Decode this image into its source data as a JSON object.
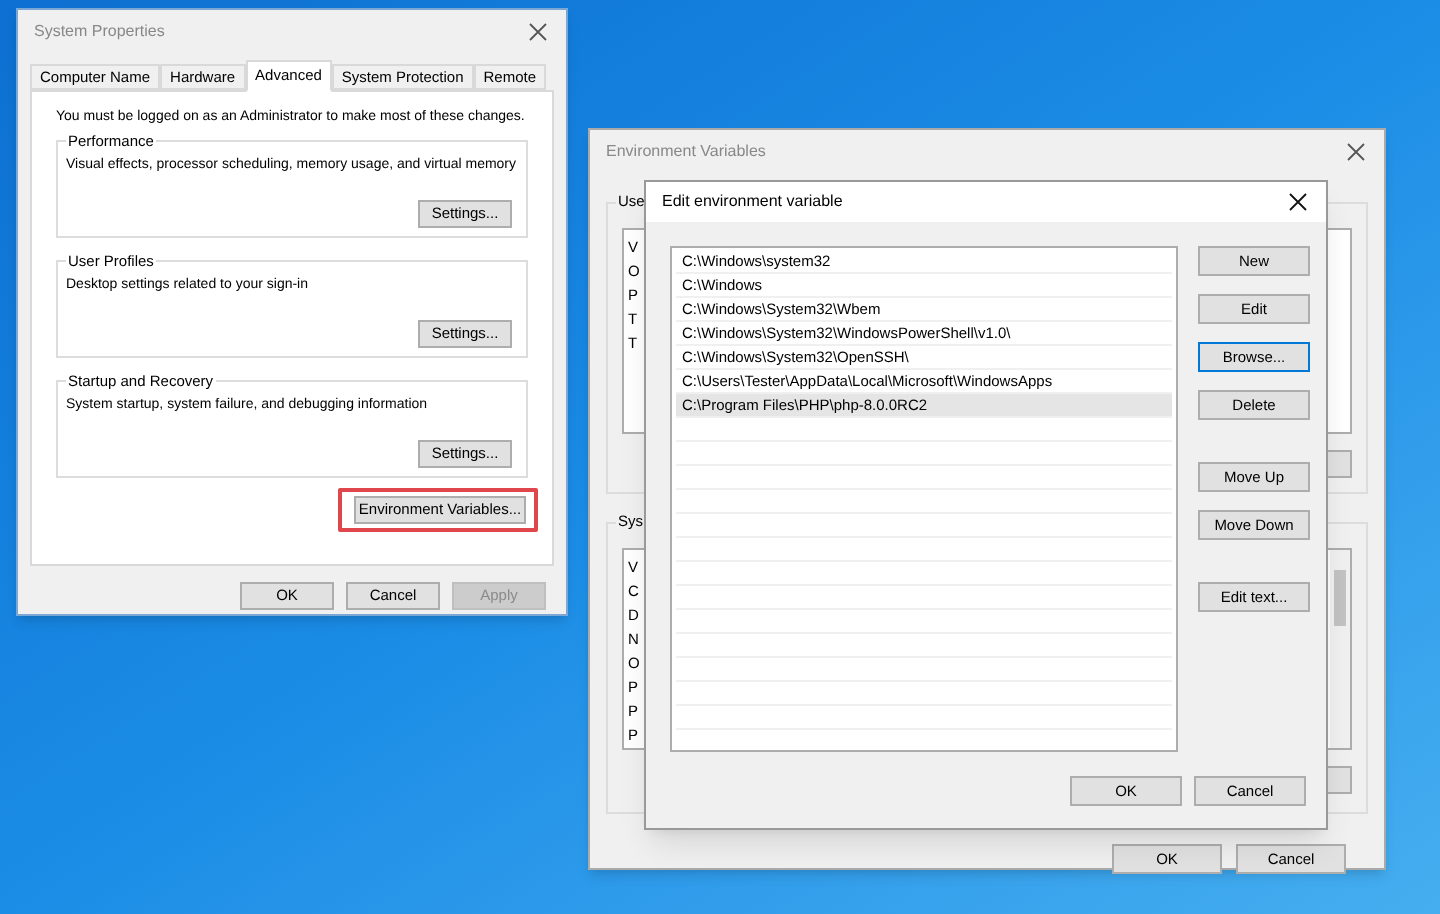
{
  "system_properties": {
    "title": "System Properties",
    "tabs": [
      {
        "label": "Computer Name",
        "selected": false
      },
      {
        "label": "Hardware",
        "selected": false
      },
      {
        "label": "Advanced",
        "selected": true
      },
      {
        "label": "System Protection",
        "selected": false
      },
      {
        "label": "Remote",
        "selected": false
      }
    ],
    "notice": "You must be logged on as an Administrator to make most of these changes.",
    "groups": [
      {
        "title": "Performance",
        "description": "Visual effects, processor scheduling, memory usage, and virtual memory",
        "button": "Settings..."
      },
      {
        "title": "User Profiles",
        "description": "Desktop settings related to your sign-in",
        "button": "Settings..."
      },
      {
        "title": "Startup and Recovery",
        "description": "System startup, system failure, and debugging information",
        "button": "Settings..."
      }
    ],
    "env_button": {
      "label": "Environment Variables...",
      "highlighted": true
    },
    "buttons": [
      {
        "label": "OK",
        "disabled": false
      },
      {
        "label": "Cancel",
        "disabled": false
      },
      {
        "label": "Apply",
        "disabled": true
      }
    ]
  },
  "environment_variables": {
    "title": "Environment Variables",
    "user_group_label": "Use",
    "user_rows": [
      "V",
      "O",
      "P",
      "T",
      "T"
    ],
    "system_group_label": "Sys",
    "system_rows": [
      "V",
      "C",
      "D",
      "N",
      "O",
      "P",
      "P",
      "P"
    ],
    "buttons": [
      "OK",
      "Cancel"
    ]
  },
  "edit_dialog": {
    "title": "Edit environment variable",
    "entries": [
      {
        "text": "C:\\Windows\\system32",
        "selected": false
      },
      {
        "text": "C:\\Windows",
        "selected": false
      },
      {
        "text": "C:\\Windows\\System32\\Wbem",
        "selected": false
      },
      {
        "text": "C:\\Windows\\System32\\WindowsPowerShell\\v1.0\\",
        "selected": false
      },
      {
        "text": "C:\\Windows\\System32\\OpenSSH\\",
        "selected": false
      },
      {
        "text": "C:\\Users\\Tester\\AppData\\Local\\Microsoft\\WindowsApps",
        "selected": false
      },
      {
        "text": "C:\\Program Files\\PHP\\php-8.0.0RC2",
        "selected": true
      }
    ],
    "button_groups": [
      [
        {
          "label": "New",
          "focused": false
        },
        {
          "label": "Edit",
          "focused": false
        },
        {
          "label": "Browse...",
          "focused": true
        },
        {
          "label": "Delete",
          "focused": false
        }
      ],
      [
        {
          "label": "Move Up",
          "focused": false
        },
        {
          "label": "Move Down",
          "focused": false
        }
      ],
      [
        {
          "label": "Edit text...",
          "focused": false
        }
      ]
    ],
    "footer_buttons": [
      "OK",
      "Cancel"
    ]
  }
}
